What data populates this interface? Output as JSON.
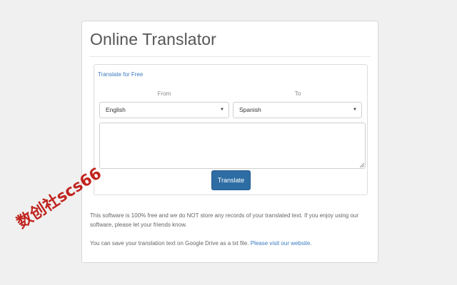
{
  "app": {
    "title": "Online Translator"
  },
  "panel": {
    "link_label": "Translate for Free",
    "from_label": "From",
    "to_label": "To",
    "from_selected": "English",
    "to_selected": "Spanish",
    "textarea_value": "",
    "translate_button": "Translate"
  },
  "info": {
    "paragraph1": "This software is 100% free and we do NOT store any records of your translated text. If you enjoy using our software, please let your friends know.",
    "paragraph2_text": "You can save your translation text on Google Drive as a txt file.",
    "paragraph2_link": "Please visit our website."
  },
  "watermark": {
    "text": "数创社scs66"
  },
  "colors": {
    "primary_button": "#2e6da4",
    "link": "#3a7bbf",
    "watermark": "#c0241e"
  },
  "icons": {
    "select_caret": "caret-down-icon",
    "resize_grip": "resize-grip-icon"
  }
}
